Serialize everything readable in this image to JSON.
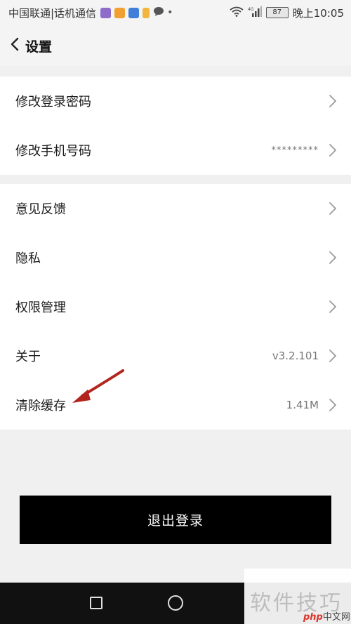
{
  "status_bar": {
    "carrier": "中国联通|话机通信",
    "battery": "87",
    "time": "晚上10:05",
    "signal_label": "4G"
  },
  "header": {
    "title": "设置"
  },
  "groups": [
    {
      "items": [
        {
          "label": "修改登录密码",
          "value": ""
        },
        {
          "label": "修改手机号码",
          "value": "*********"
        }
      ]
    },
    {
      "items": [
        {
          "label": "意见反馈",
          "value": ""
        },
        {
          "label": "隐私",
          "value": ""
        },
        {
          "label": "权限管理",
          "value": ""
        },
        {
          "label": "关于",
          "value": "v3.2.101"
        },
        {
          "label": "清除缓存",
          "value": "1.41M"
        }
      ]
    }
  ],
  "logout": {
    "label": "退出登录"
  },
  "watermark": {
    "text": "软件技巧",
    "site_php": "php",
    "site_rest": "中文网"
  },
  "colors": {
    "accent_black": "#000000",
    "annotation_red": "#b3241c",
    "background": "#f0f0f0"
  },
  "icons": {
    "back": "chevron-left-icon",
    "row": "chevron-right-icon",
    "nav_recent": "square-icon",
    "nav_home": "circle-icon"
  }
}
